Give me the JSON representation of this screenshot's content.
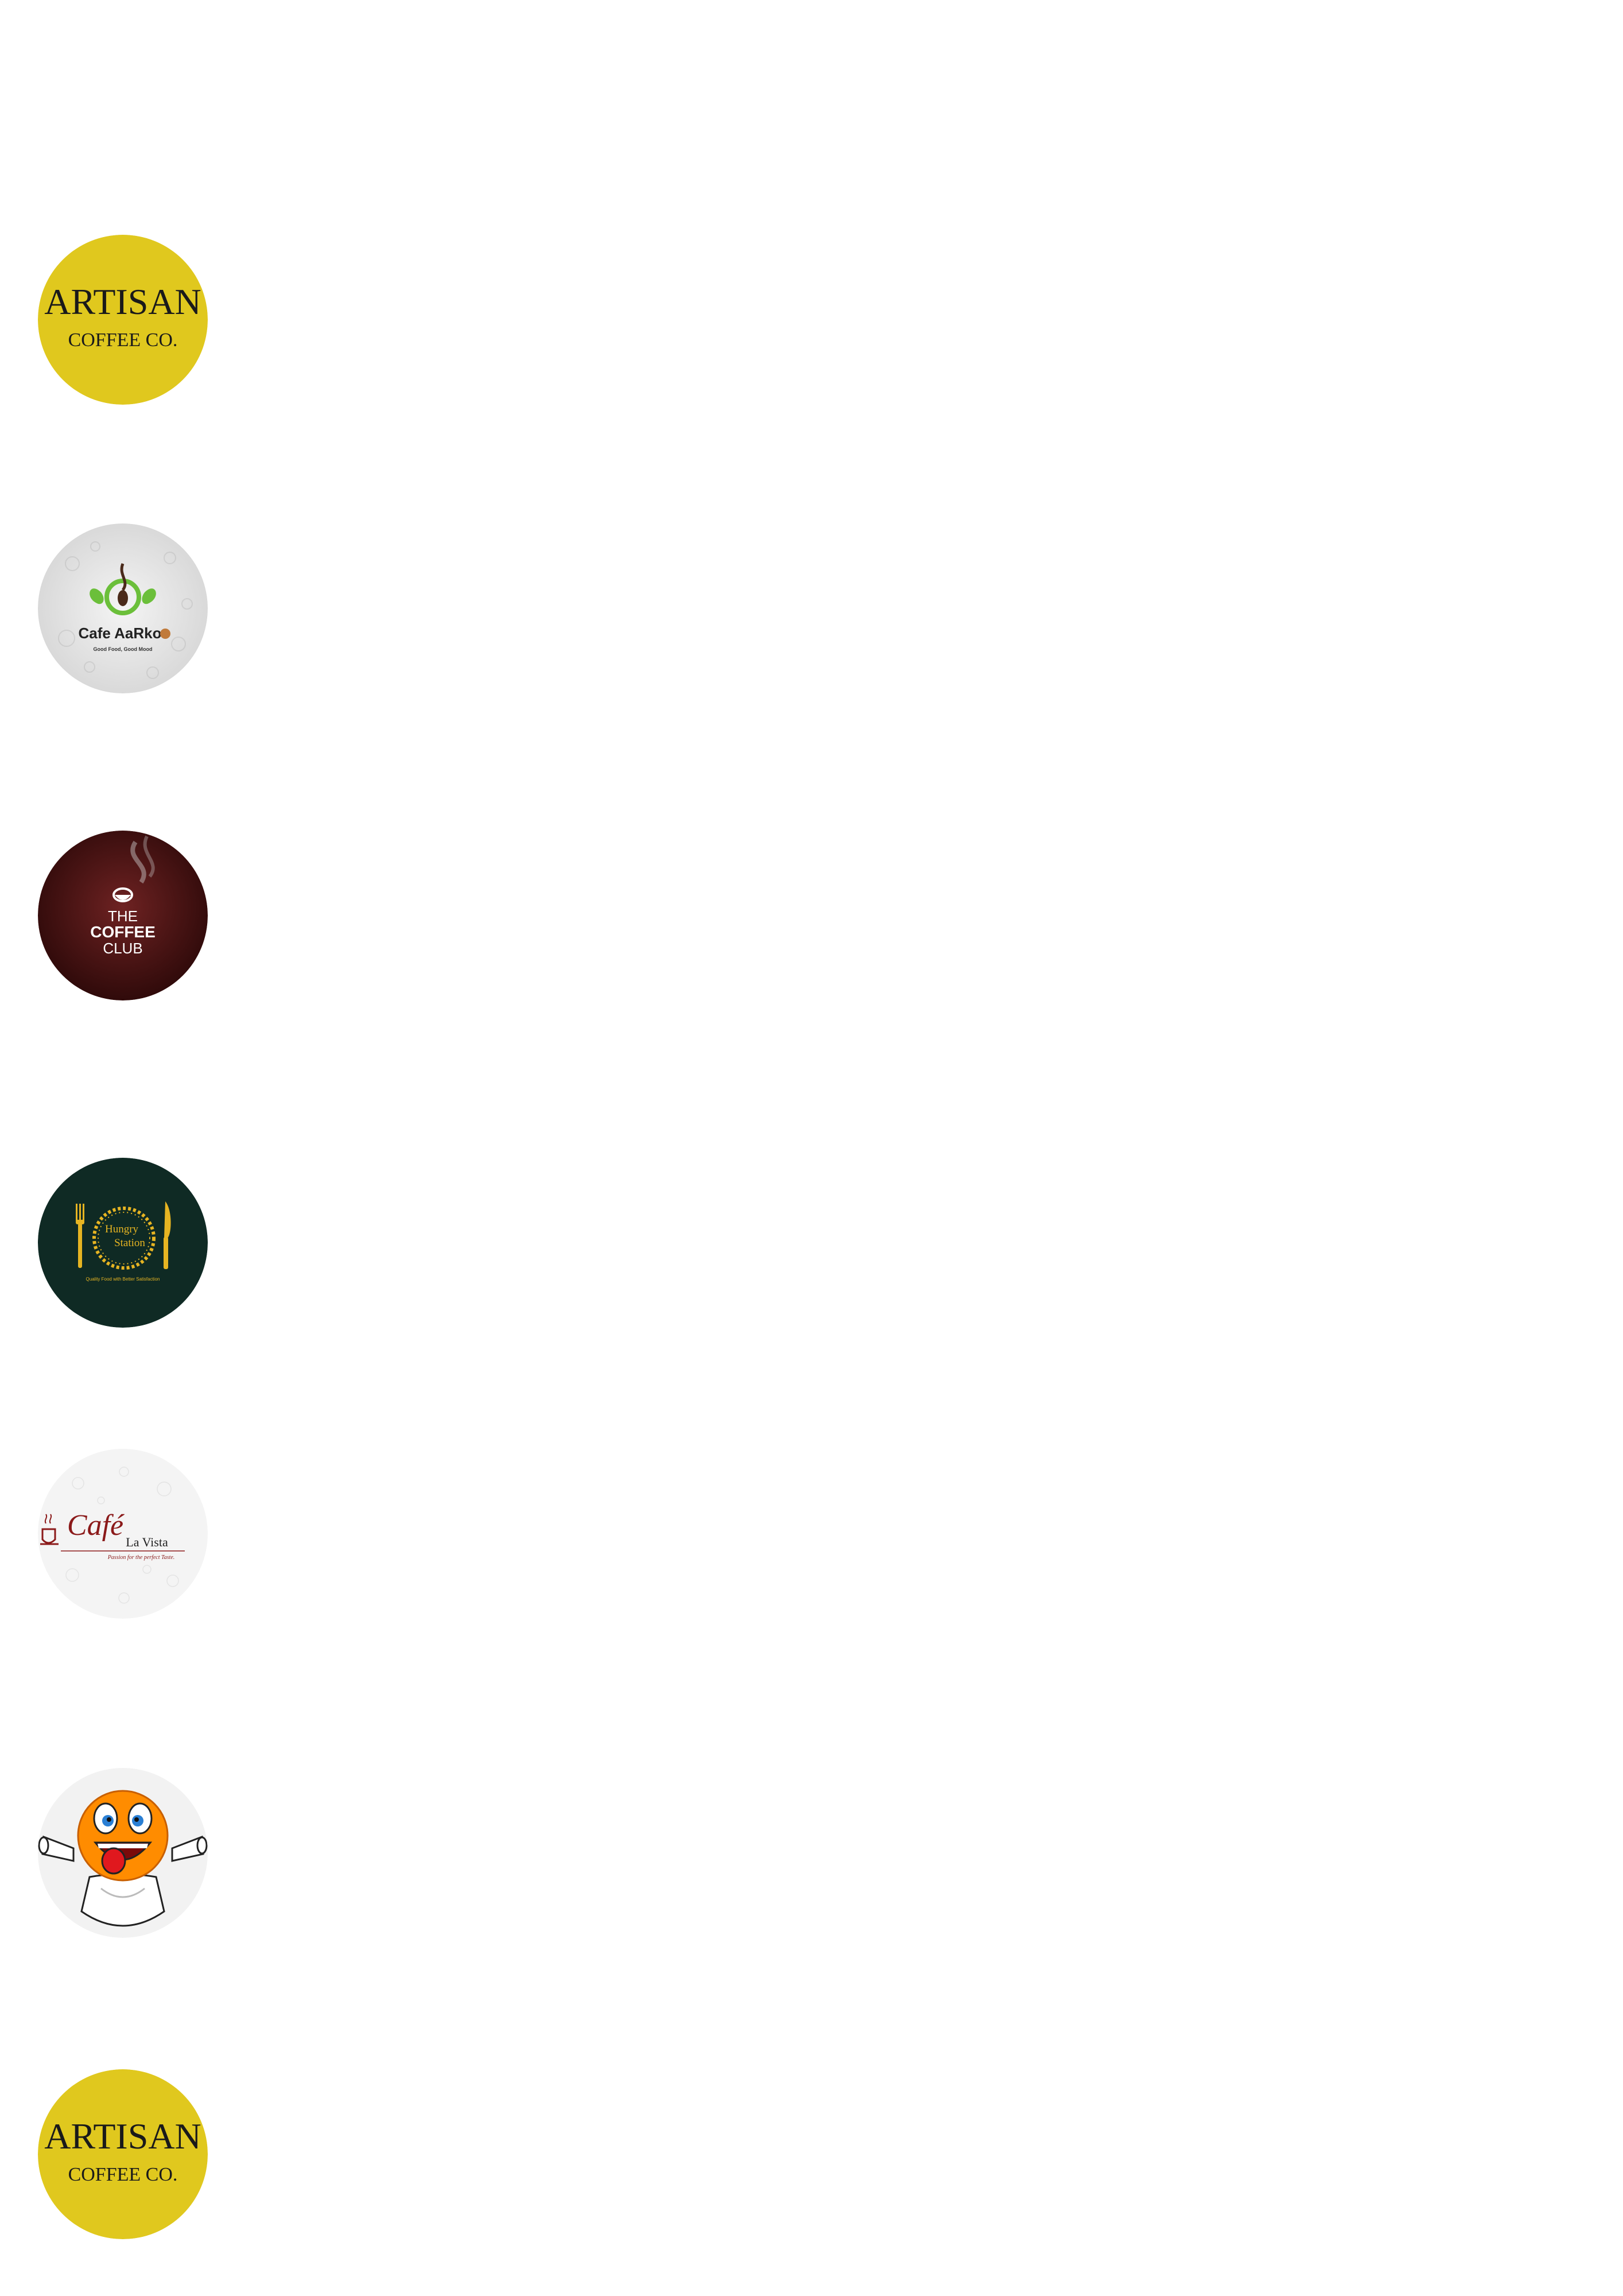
{
  "logos": [
    {
      "name": "ARTISAN COFFEE CO.",
      "line1": "ARTISAN",
      "line2": "COFFEE CO.",
      "bg": "#e0c81e",
      "text_color": "#1a1a1a"
    },
    {
      "name": "Cafe AaRko",
      "title": "Cafe AaRko",
      "tagline": "Good Food, Good Mood",
      "bg": "#e7e7e7",
      "accent": "#6bbf3a"
    },
    {
      "name": "THE COFFEE CLUB",
      "line1": "THE",
      "line2": "COFFEE",
      "line3": "CLUB",
      "bg": "#4a1414",
      "text_color": "#ffffff"
    },
    {
      "name": "Hungry Station",
      "line1": "Hungry",
      "line2": "Station",
      "tagline": "Quality Food with Better Satisfaction",
      "bg": "#0f2a24",
      "accent": "#e6b422"
    },
    {
      "name": "Cafe La Vista",
      "title": "Café",
      "subtitle": "La Vista",
      "tagline": "Passion for the perfect Taste.",
      "bg": "#f4f4f4",
      "accent": "#8b1a1a"
    },
    {
      "name": "Cartoon mascot",
      "bg": "#f2f2f2",
      "accent": "#ff8c00"
    },
    {
      "name": "ARTISAN COFFEE CO.",
      "line1": "ARTISAN",
      "line2": "COFFEE CO.",
      "bg": "#e0c81e",
      "text_color": "#1a1a1a"
    }
  ]
}
